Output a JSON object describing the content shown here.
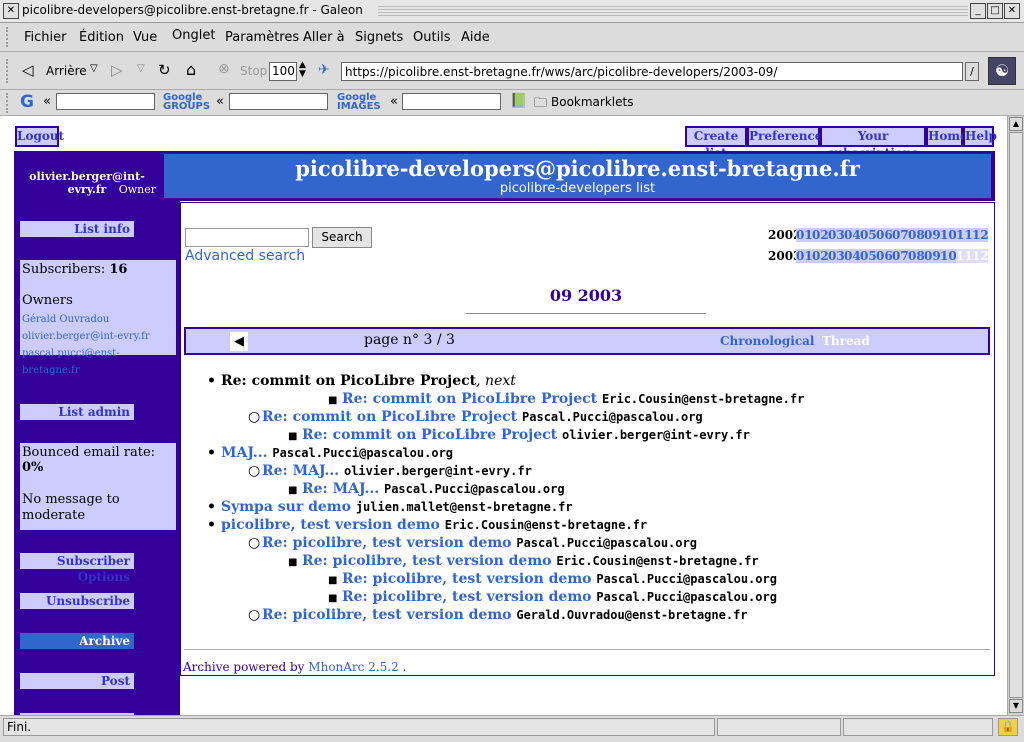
{
  "window": {
    "title": "picolibre-developers@picolibre.enst-bretagne.fr - Galeon"
  },
  "menu": [
    "Fichier",
    "Édition",
    "Vue",
    "Onglet",
    "Paramètres",
    "Aller à",
    "Signets",
    "Outils",
    "Aide"
  ],
  "nav": {
    "back": "Arrière",
    "stop": "Stop",
    "zoom": "100",
    "url": "https://picolibre.enst-bretagne.fr/wws/arc/picolibre-developers/2003-09/"
  },
  "search_toolbar": {
    "google_groups": "Google GROUPS",
    "google_images": "Google IMAGES",
    "bookmarklets": "Bookmarklets"
  },
  "top_links": {
    "logout": "Logout",
    "create_list": "Create list",
    "preferences": "Preferences",
    "subscriptions": "Your subscriptions",
    "home": "Home",
    "help": "Help"
  },
  "header": {
    "user": "olivier.berger@int-evry.fr",
    "role": "Owner",
    "list_address": "picolibre-developers@picolibre.enst-bretagne.fr",
    "list_desc": "picolibre-developers list"
  },
  "sidebar": {
    "list_info": "List info",
    "subscribers_label": "Subscribers:",
    "subscribers_count": "16",
    "owners_label": "Owners",
    "owners": [
      "Gérald Ouvradou",
      "olivier.berger@int-evry.fr",
      "pascal.pucci@enst-bretagne.fr"
    ],
    "list_admin": "List admin",
    "bounce_label": "Bounced email rate:",
    "bounce_rate": "0%",
    "no_message": "No message to moderate",
    "subscriber_options": "Subscriber Options",
    "unsubscribe": "Unsubscribe",
    "archive": "Archive",
    "post": "Post"
  },
  "archive": {
    "search_button": "Search",
    "advanced_search": "Advanced search",
    "years": [
      {
        "year": "2002",
        "months": [
          "01",
          "02",
          "03",
          "04",
          "05",
          "06",
          "07",
          "08",
          "09",
          "10",
          "11",
          "12"
        ],
        "available": [
          true,
          true,
          true,
          true,
          true,
          true,
          true,
          true,
          true,
          true,
          true,
          true
        ]
      },
      {
        "year": "2003",
        "months": [
          "01",
          "02",
          "03",
          "04",
          "05",
          "06",
          "07",
          "08",
          "09",
          "10",
          "11",
          "12"
        ],
        "available": [
          true,
          true,
          true,
          true,
          true,
          true,
          true,
          true,
          true,
          true,
          false,
          false
        ]
      }
    ],
    "period": "09 2003",
    "page": "page n° 3 / 3",
    "chronological": "Chronological",
    "thread_label": "Thread",
    "messages": [
      {
        "level": 0,
        "subject": "Re: commit on PicoLibre Project",
        "suffix": ", next",
        "author": "",
        "link": false
      },
      {
        "level": 3,
        "subject": "Re: commit on PicoLibre Project",
        "author": "Eric.Cousin@enst-bretagne.fr",
        "link": true
      },
      {
        "level": 1,
        "subject": "Re: commit on PicoLibre Project",
        "author": "Pascal.Pucci@pascalou.org",
        "link": true
      },
      {
        "level": 2,
        "subject": "Re: commit on PicoLibre Project",
        "author": "olivier.berger@int-evry.fr",
        "link": true
      },
      {
        "level": 0,
        "subject": "MAJ...",
        "author": "Pascal.Pucci@pascalou.org",
        "link": true
      },
      {
        "level": 1,
        "subject": "Re: MAJ...",
        "author": "olivier.berger@int-evry.fr",
        "link": true
      },
      {
        "level": 2,
        "subject": "Re: MAJ...",
        "author": "Pascal.Pucci@pascalou.org",
        "link": true
      },
      {
        "level": 0,
        "subject": "Sympa sur demo",
        "author": "julien.mallet@enst-bretagne.fr",
        "link": true
      },
      {
        "level": 0,
        "subject": "picolibre, test version demo",
        "author": "Eric.Cousin@enst-bretagne.fr",
        "link": true
      },
      {
        "level": 1,
        "subject": "Re: picolibre, test version demo",
        "author": "Pascal.Pucci@pascalou.org",
        "link": true
      },
      {
        "level": 2,
        "subject": "Re: picolibre, test version demo",
        "author": "Eric.Cousin@enst-bretagne.fr",
        "link": true
      },
      {
        "level": 3,
        "subject": "Re: picolibre, test version demo",
        "author": "Pascal.Pucci@pascalou.org",
        "link": true
      },
      {
        "level": 3,
        "subject": "Re: picolibre, test version demo",
        "author": "Pascal.Pucci@pascalou.org",
        "link": true
      },
      {
        "level": 1,
        "subject": "Re: picolibre, test version demo",
        "author": "Gerald.Ouvradou@enst-bretagne.fr",
        "link": true
      }
    ],
    "powered_by": "Archive powered by",
    "mhonarc": "MhonArc 2.5.2",
    "powered_suffix": "."
  },
  "status": {
    "text": "Fini."
  },
  "colors": {
    "accent": "#330099",
    "header_bg": "#3366cc",
    "panel": "#ccccff",
    "link": "#3366cc"
  }
}
